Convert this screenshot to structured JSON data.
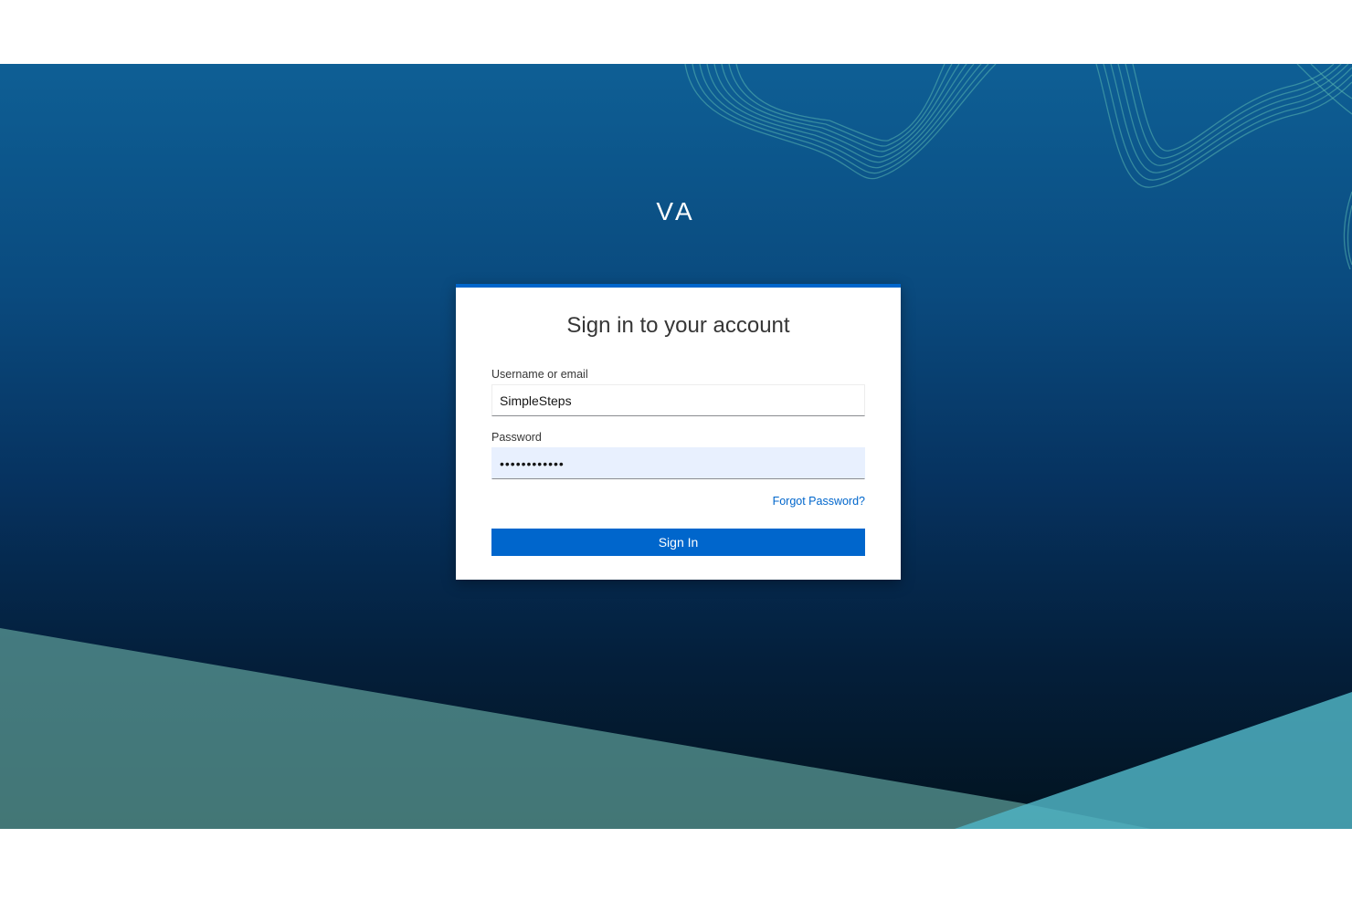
{
  "realm": {
    "title": "VA"
  },
  "login": {
    "heading": "Sign in to your account",
    "username_label": "Username or email",
    "username_value": "SimpleSteps",
    "password_label": "Password",
    "password_value": "••••••••••••",
    "forgot_password": "Forgot Password?",
    "submit_label": "Sign In"
  },
  "theme": {
    "accent": "#0066cc",
    "background_top": "#0e5f95",
    "background_bottom": "#02131f",
    "teal": "#4ba5b5"
  },
  "icons": {
    "background_lines": "wave-lines-decoration"
  }
}
